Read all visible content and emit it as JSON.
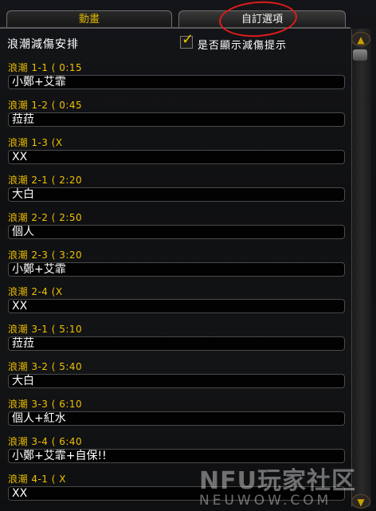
{
  "tabs": [
    {
      "label": "動畫"
    },
    {
      "label": "自訂選項"
    }
  ],
  "section": {
    "title": "浪潮減傷安排",
    "show_reminder_label": "是否顯示減傷提示",
    "show_reminder_checked": true
  },
  "waves": [
    {
      "label": "浪潮 1-1 ( 0:15",
      "value": "小鄭+艾霏"
    },
    {
      "label": "浪潮 1-2 ( 0:45",
      "value": "菈菈"
    },
    {
      "label": "浪潮 1-3 (X",
      "value": "XX"
    },
    {
      "label": "浪潮 2-1 ( 2:20",
      "value": "大白"
    },
    {
      "label": "浪潮 2-2 ( 2:50",
      "value": "個人"
    },
    {
      "label": "浪潮 2-3 ( 3:20",
      "value": "小鄭+艾霏"
    },
    {
      "label": "浪潮 2-4 (X",
      "value": "XX"
    },
    {
      "label": "浪潮 3-1 ( 5:10",
      "value": "菈菈"
    },
    {
      "label": "浪潮 3-2 ( 5:40",
      "value": "大白"
    },
    {
      "label": "浪潮 3-3 ( 6:10",
      "value": "個人+紅水"
    },
    {
      "label": "浪潮 3-4 ( 6:40",
      "value": "小鄭+艾霏+自保!!"
    },
    {
      "label": "浪潮 4-1 ( X",
      "value": "XX"
    }
  ],
  "watermark": {
    "logo": "NFU玩家社区",
    "sub": "NEUWOW.COM"
  },
  "icons": {
    "scroll_up": "chevron-up-icon",
    "scroll_down": "chevron-down-icon",
    "check": "checkmark-icon"
  },
  "colors": {
    "label_gold": "#f0c000",
    "annotation_red": "#e01b1b"
  }
}
